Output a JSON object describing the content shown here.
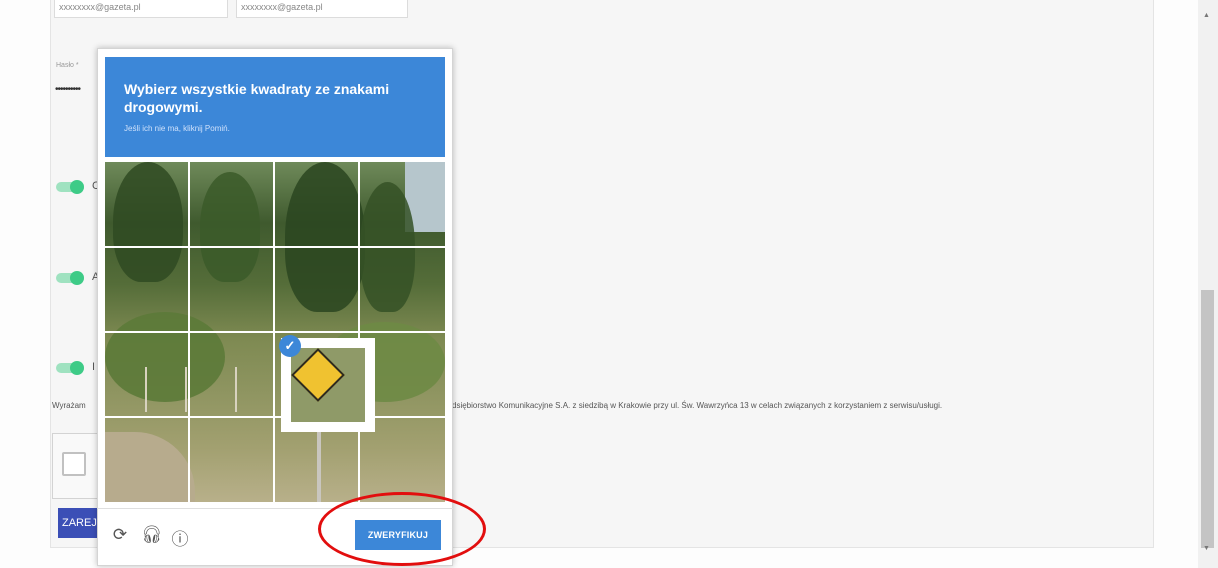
{
  "form": {
    "email_value_1": "xxxxxxxx@gazeta.pl",
    "email_value_2": "xxxxxxxx@gazeta.pl",
    "password_label": "Hasło *",
    "password_value": "••••••••••",
    "toggle_labels": [
      "C",
      "A",
      "I"
    ],
    "consent_text_left": "Wyrażam",
    "consent_text_right": "dsiębiorstwo Komunikacyjne S.A. z siedzibą w Krakowie przy ul. Św. Wawrzyńca 13 w celach związanych z korzystaniem z serwisu/usługi.",
    "submit_label": "ZAREJESTRUJ"
  },
  "challenge": {
    "title_plain": "Wybierz wszystkie kwadraty ze ",
    "title_highlight": "znakami drogowymi.",
    "subtitle": "Jeśli ich nie ma, kliknij Pomiń.",
    "verify_label": "ZWERYFIKUJ",
    "icons": {
      "reload": "reload-icon",
      "audio": "headphones-icon",
      "info": "info-icon"
    },
    "selected_tiles": [
      10
    ]
  },
  "colors": {
    "header_blue": "#3c87d8",
    "toggle_green": "#3ecb87",
    "submit_blue": "#3b4fb6",
    "annotation_red": "#e20e0e"
  }
}
